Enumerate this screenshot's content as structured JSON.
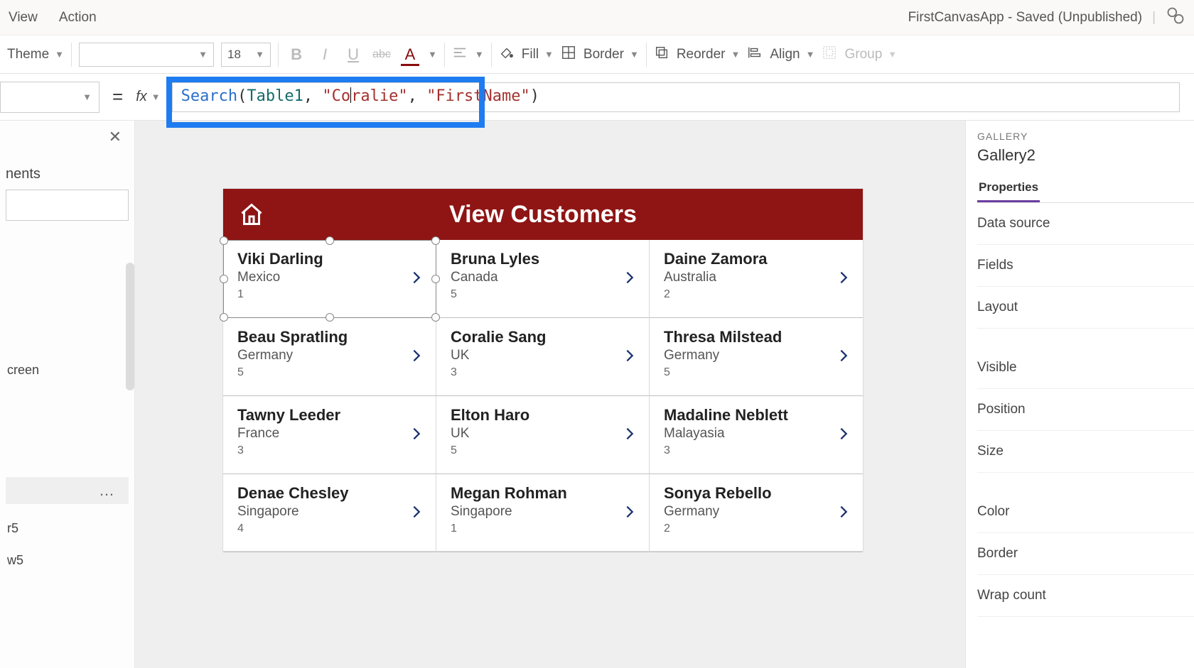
{
  "menubar": {
    "view": "View",
    "action": "Action"
  },
  "app_status": "FirstCanvasApp - Saved (Unpublished)",
  "toolbar": {
    "theme": "Theme",
    "font_name": "",
    "font_size": "18",
    "bold": "B",
    "italic": "I",
    "underline": "U",
    "strike": "abc",
    "fontcolor": "A",
    "fill": "Fill",
    "border": "Border",
    "reorder": "Reorder",
    "align": "Align",
    "group": "Group"
  },
  "formula": {
    "fx": "fx",
    "fn": "Search",
    "open": "(",
    "id": "Table1",
    "c1": ", ",
    "s1a": "\"Co",
    "s1b": "ralie\"",
    "c2": ", ",
    "s2": "\"FirstName\"",
    "close": ")"
  },
  "left": {
    "heading": "nents",
    "item_screen": "creen",
    "item_r5": "r5",
    "item_w5": "w5",
    "more": "…"
  },
  "canvas": {
    "title": "View Customers",
    "cards": [
      {
        "name": "Viki  Darling",
        "sub": "Mexico",
        "num": "1"
      },
      {
        "name": "Bruna  Lyles",
        "sub": "Canada",
        "num": "5"
      },
      {
        "name": "Daine  Zamora",
        "sub": "Australia",
        "num": "2"
      },
      {
        "name": "Beau  Spratling",
        "sub": "Germany",
        "num": "5"
      },
      {
        "name": "Coralie  Sang",
        "sub": "UK",
        "num": "3"
      },
      {
        "name": "Thresa  Milstead",
        "sub": "Germany",
        "num": "5"
      },
      {
        "name": "Tawny  Leeder",
        "sub": "France",
        "num": "3"
      },
      {
        "name": "Elton  Haro",
        "sub": "UK",
        "num": "5"
      },
      {
        "name": "Madaline  Neblett",
        "sub": "Malayasia",
        "num": "3"
      },
      {
        "name": "Denae  Chesley",
        "sub": "Singapore",
        "num": "4"
      },
      {
        "name": "Megan  Rohman",
        "sub": "Singapore",
        "num": "1"
      },
      {
        "name": "Sonya  Rebello",
        "sub": "Germany",
        "num": "2"
      }
    ]
  },
  "right": {
    "category": "GALLERY",
    "name": "Gallery2",
    "tab": "Properties",
    "rows": [
      "Data source",
      "Fields",
      "Layout",
      "Visible",
      "Position",
      "Size",
      "Color",
      "Border",
      "Wrap count"
    ]
  }
}
